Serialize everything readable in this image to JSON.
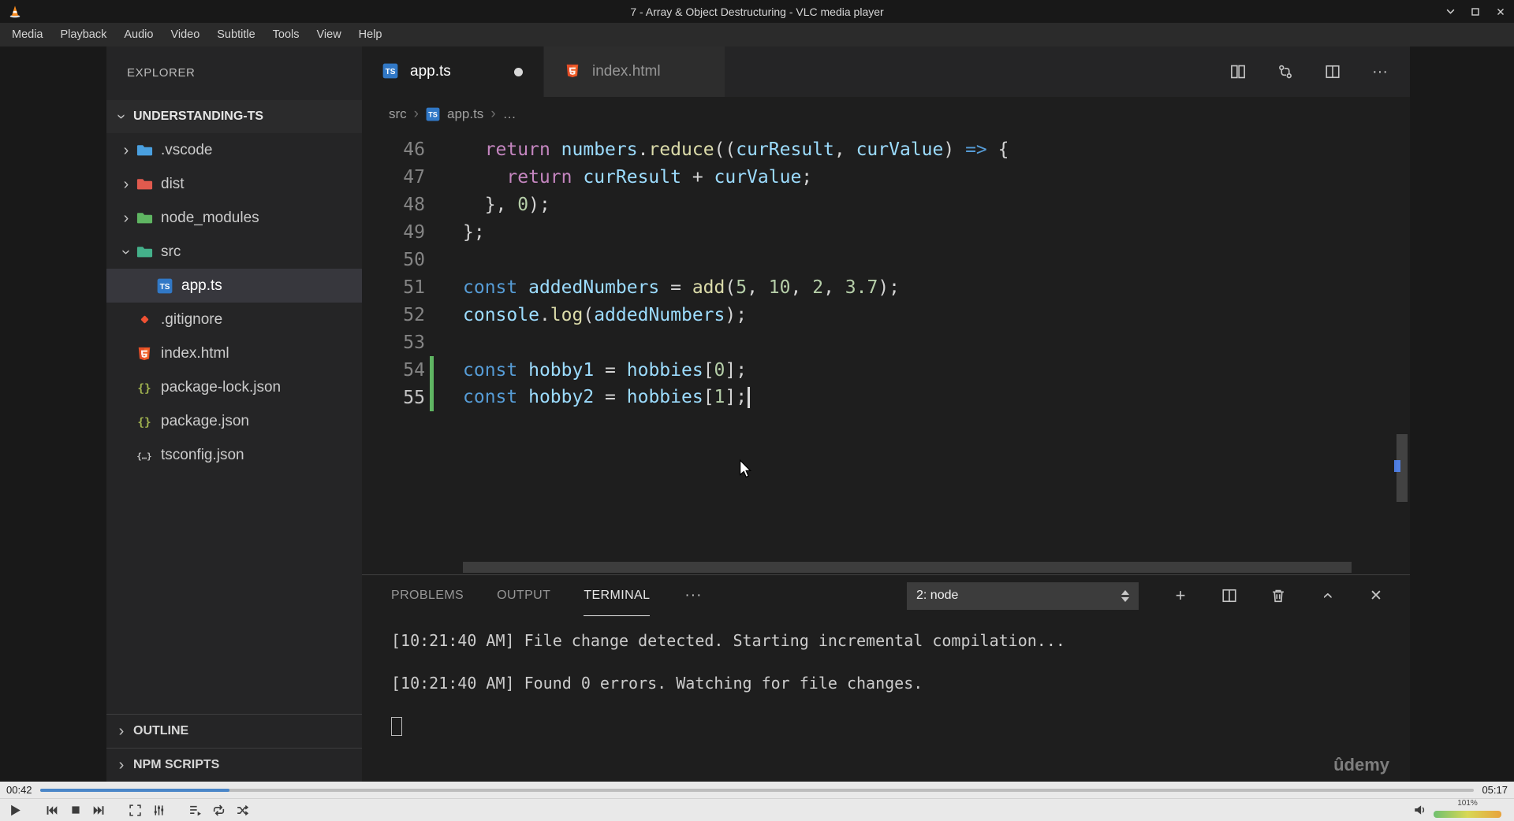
{
  "icons": {
    "chevron": "›",
    "more": "···",
    "plus": "+",
    "close": "✕"
  },
  "vlc": {
    "title": "7 - Array & Object Destructuring - VLC media player",
    "menu": [
      "Media",
      "Playback",
      "Audio",
      "Video",
      "Subtitle",
      "Tools",
      "View",
      "Help"
    ],
    "seek": {
      "elapsed": "00:42",
      "total": "05:17",
      "progress_percent": 13.2
    },
    "volume": {
      "label": "101%"
    }
  },
  "vscode": {
    "explorer": {
      "header": "EXPLORER",
      "project": "UNDERSTANDING-TS",
      "items": [
        {
          "label": ".vscode",
          "kind": "folder",
          "color": "#4aa0e0",
          "expanded": false,
          "indent": 0
        },
        {
          "label": "dist",
          "kind": "folder",
          "color": "#e05a4e",
          "expanded": false,
          "indent": 0
        },
        {
          "label": "node_modules",
          "kind": "folder",
          "color": "#5fb562",
          "expanded": false,
          "indent": 0
        },
        {
          "label": "src",
          "kind": "folder",
          "color": "#44b08a",
          "expanded": true,
          "indent": 0
        },
        {
          "label": "app.ts",
          "kind": "ts",
          "indent": 1,
          "selected": true
        },
        {
          "label": ".gitignore",
          "kind": "git",
          "indent": 0
        },
        {
          "label": "index.html",
          "kind": "html",
          "indent": 0
        },
        {
          "label": "package-lock.json",
          "kind": "json",
          "color": "#a0b24f",
          "indent": 0
        },
        {
          "label": "package.json",
          "kind": "json",
          "color": "#a0b24f",
          "indent": 0
        },
        {
          "label": "tsconfig.json",
          "kind": "tsconfig",
          "color": "#c5c5c5",
          "indent": 0
        }
      ],
      "bottom_sections": [
        "OUTLINE",
        "NPM SCRIPTS"
      ]
    },
    "tabs": [
      {
        "label": "app.ts",
        "kind": "ts",
        "active": true,
        "modified": true
      },
      {
        "label": "index.html",
        "kind": "html",
        "active": false,
        "modified": false
      }
    ],
    "breadcrumb": {
      "root": "src",
      "file": "app.ts",
      "more": "…"
    },
    "editor": {
      "token_colors": {
        "kw": "#569cd6",
        "ctrl": "#c586c0",
        "var": "#9cdcfe",
        "fn": "#dcdcaa",
        "num": "#b5cea8",
        "pun": "#d4d4d4"
      },
      "lines": [
        {
          "num": "46",
          "tokens": [
            [
              "  ",
              "pun"
            ],
            [
              "return",
              "ctrl"
            ],
            [
              " ",
              "pun"
            ],
            [
              "numbers",
              "var"
            ],
            [
              ".",
              "pun"
            ],
            [
              "reduce",
              "fn"
            ],
            [
              "((",
              "pun"
            ],
            [
              "curResult",
              "var"
            ],
            [
              ", ",
              "pun"
            ],
            [
              "curValue",
              "var"
            ],
            [
              ") ",
              "pun"
            ],
            [
              "=>",
              "kw"
            ],
            [
              " {",
              "pun"
            ]
          ]
        },
        {
          "num": "47",
          "tokens": [
            [
              "    ",
              "pun"
            ],
            [
              "return",
              "ctrl"
            ],
            [
              " ",
              "pun"
            ],
            [
              "curResult",
              "var"
            ],
            [
              " + ",
              "pun"
            ],
            [
              "curValue",
              "var"
            ],
            [
              ";",
              "pun"
            ]
          ]
        },
        {
          "num": "48",
          "tokens": [
            [
              "  }, ",
              "pun"
            ],
            [
              "0",
              "num"
            ],
            [
              ");",
              "pun"
            ]
          ]
        },
        {
          "num": "49",
          "tokens": [
            [
              "};",
              "pun"
            ]
          ]
        },
        {
          "num": "50",
          "tokens": []
        },
        {
          "num": "51",
          "tokens": [
            [
              "const",
              "kw"
            ],
            [
              " ",
              "pun"
            ],
            [
              "addedNumbers",
              "var"
            ],
            [
              " = ",
              "pun"
            ],
            [
              "add",
              "fn"
            ],
            [
              "(",
              "pun"
            ],
            [
              "5",
              "num"
            ],
            [
              ", ",
              "pun"
            ],
            [
              "10",
              "num"
            ],
            [
              ", ",
              "pun"
            ],
            [
              "2",
              "num"
            ],
            [
              ", ",
              "pun"
            ],
            [
              "3.7",
              "num"
            ],
            [
              ");",
              "pun"
            ]
          ]
        },
        {
          "num": "52",
          "tokens": [
            [
              "console",
              "var"
            ],
            [
              ".",
              "pun"
            ],
            [
              "log",
              "fn"
            ],
            [
              "(",
              "pun"
            ],
            [
              "addedNumbers",
              "var"
            ],
            [
              ");",
              "pun"
            ]
          ]
        },
        {
          "num": "53",
          "tokens": []
        },
        {
          "num": "54",
          "changed": true,
          "tokens": [
            [
              "const",
              "kw"
            ],
            [
              " ",
              "pun"
            ],
            [
              "hobby1",
              "var"
            ],
            [
              " = ",
              "pun"
            ],
            [
              "hobbies",
              "var"
            ],
            [
              "[",
              "pun"
            ],
            [
              "0",
              "num"
            ],
            [
              "];",
              "pun"
            ]
          ]
        },
        {
          "num": "55",
          "changed": true,
          "cursor": true,
          "tokens": [
            [
              "const",
              "kw"
            ],
            [
              " ",
              "pun"
            ],
            [
              "hobby2",
              "var"
            ],
            [
              " = ",
              "pun"
            ],
            [
              "hobbies",
              "var"
            ],
            [
              "[",
              "pun"
            ],
            [
              "1",
              "num"
            ],
            [
              "];",
              "pun"
            ]
          ]
        }
      ]
    },
    "panel": {
      "tabs": [
        "PROBLEMS",
        "OUTPUT",
        "TERMINAL"
      ],
      "active_tab_index": 2,
      "dropdown": "2: node",
      "terminal_lines": [
        "[10:21:40 AM] File change detected. Starting incremental compilation...",
        "",
        "[10:21:40 AM] Found 0 errors. Watching for file changes.",
        ""
      ]
    },
    "watermark": "ûdemy"
  }
}
